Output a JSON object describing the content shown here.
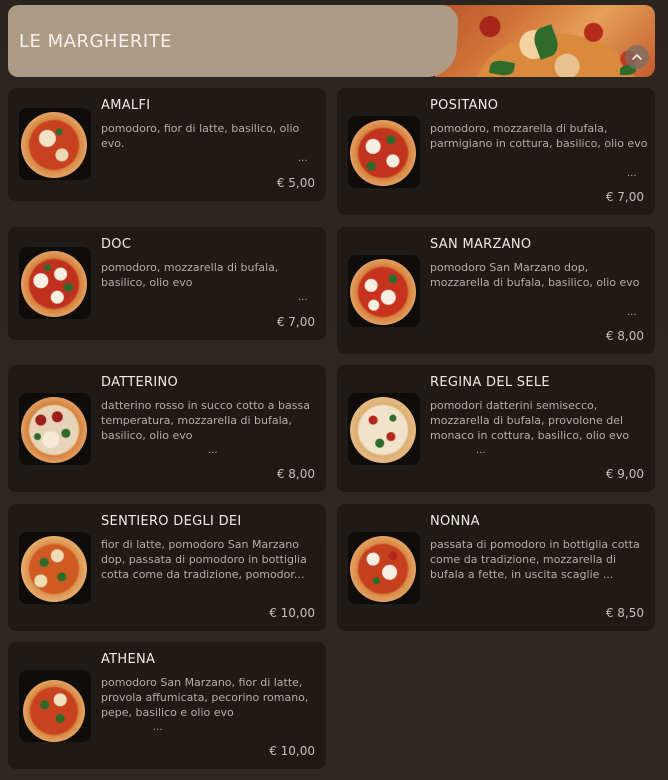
{
  "section": {
    "title": "LE MARGHERITE"
  },
  "icons": {
    "collapse": "chevron-up-icon"
  },
  "items": [
    {
      "name": "AMALFI",
      "description": "pomodoro, fior di latte, basilico, olio evo.",
      "more": "...",
      "price": "€ 5,00"
    },
    {
      "name": "POSITANO",
      "description": "pomodoro, mozzarella di bufala, parmigiano in cottura, basilico, olio evo",
      "more": "...",
      "price": "€ 7,00"
    },
    {
      "name": "DOC",
      "description": "pomodoro, mozzarella di bufala, basilico, olio evo",
      "more": "...",
      "price": "€ 7,00"
    },
    {
      "name": "SAN MARZANO",
      "description": "pomodoro San Marzano dop, mozzarella di bufala, basilico, olio evo",
      "more": "...",
      "price": "€ 8,00"
    },
    {
      "name": "DATTERINO",
      "description": "datterino rosso in succo cotto a bassa temperatura, mozzarella di bufala, basilico, olio evo",
      "more": "...",
      "price": "€ 8,00"
    },
    {
      "name": "REGINA DEL SELE",
      "description": "pomodori datterini semisecco, mozzarella di bufala, provolone del monaco in cottura, basilico, olio evo",
      "more": "...",
      "price": "€ 9,00"
    },
    {
      "name": "SENTIERO DEGLI DEI",
      "description": "fior di latte, pomodoro San Marzano dop, passata di pomodoro in bottiglia cotta come da tradizione, pomodor...",
      "more": "",
      "price": "€ 10,00"
    },
    {
      "name": "NONNA",
      "description": "passata di pomodoro in bottiglia cotta come da tradizione, mozzarella di bufala a fette, in uscita scaglie ...",
      "more": "",
      "price": "€ 8,50"
    },
    {
      "name": "ATHENA",
      "description": "pomodoro San Marzano, fior di latte, provola affumicata, pecorino romano, pepe, basilico e olio evo",
      "more": "...",
      "price": "€ 10,00"
    }
  ]
}
